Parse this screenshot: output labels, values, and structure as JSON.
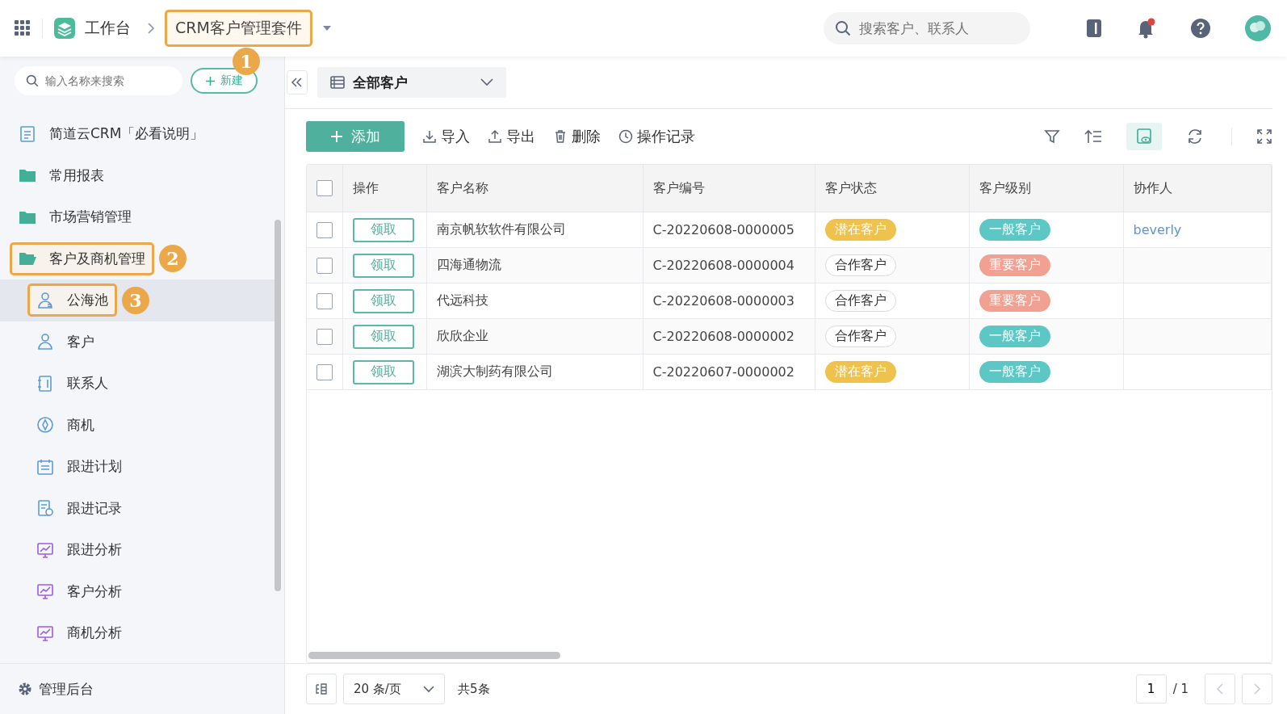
{
  "topbar": {
    "home": "工作台",
    "app": {
      "label": "CRM客户管理套件",
      "callout": "1"
    },
    "search": {
      "placeholder": "搜索客户、联系人"
    },
    "notification_dot": true
  },
  "sidebar": {
    "search": {
      "placeholder": "输入名称来搜索"
    },
    "new_button": "新建",
    "items": [
      {
        "label": "简道云CRM「必看说明」",
        "kind": "document",
        "selected": false
      },
      {
        "label": "常用报表",
        "kind": "folder",
        "selected": false,
        "expanded": false
      },
      {
        "label": "市场营销管理",
        "kind": "folder",
        "selected": false,
        "expanded": false
      },
      {
        "label": "客户及商机管理",
        "kind": "folder",
        "selected": false,
        "expanded": true,
        "callout": "2",
        "children": [
          {
            "label": "公海池",
            "kind": "pool",
            "selected": true,
            "callout": "3"
          },
          {
            "label": "客户",
            "kind": "person",
            "selected": false
          },
          {
            "label": "联系人",
            "kind": "book",
            "selected": false
          },
          {
            "label": "商机",
            "kind": "compass",
            "selected": false
          },
          {
            "label": "跟进计划",
            "kind": "calendar",
            "selected": false
          },
          {
            "label": "跟进记录",
            "kind": "record",
            "selected": false
          },
          {
            "label": "跟进分析",
            "kind": "dashboard",
            "selected": false
          },
          {
            "label": "客户分析",
            "kind": "dashboard",
            "selected": false
          },
          {
            "label": "商机分析",
            "kind": "dashboard",
            "selected": false
          }
        ]
      }
    ],
    "footer": "管理后台"
  },
  "view": {
    "title": "全部客户"
  },
  "toolbar": {
    "add": "添加",
    "actions": [
      {
        "label": "导入",
        "kind": "import"
      },
      {
        "label": "导出",
        "kind": "export"
      },
      {
        "label": "删除",
        "kind": "delete"
      },
      {
        "label": "操作记录",
        "kind": "history"
      }
    ]
  },
  "table": {
    "select_all_checked": false,
    "columns": [
      "操作",
      "客户名称",
      "客户编号",
      "客户状态",
      "客户级别",
      "协作人"
    ],
    "rows": [
      {
        "checked": false,
        "action": "领取",
        "name": "南京帆软软件有限公司",
        "code": "C-20220608-0000005",
        "status": {
          "label": "潜在客户",
          "kind": "filled",
          "color": "#efc24e"
        },
        "level": {
          "label": "一般客户",
          "color": "#5cc7c5"
        },
        "collaborator": "beverly"
      },
      {
        "checked": false,
        "action": "领取",
        "name": "四海通物流",
        "code": "C-20220608-0000004",
        "status": {
          "label": "合作客户",
          "kind": "outline"
        },
        "level": {
          "label": "重要客户",
          "color": "#f0a192"
        }
      },
      {
        "checked": false,
        "action": "领取",
        "name": "代远科技",
        "code": "C-20220608-0000003",
        "status": {
          "label": "合作客户",
          "kind": "outline"
        },
        "level": {
          "label": "重要客户",
          "color": "#f0a192"
        }
      },
      {
        "checked": false,
        "action": "领取",
        "name": "欣欣企业",
        "code": "C-20220608-0000002",
        "status": {
          "label": "合作客户",
          "kind": "outline"
        },
        "level": {
          "label": "一般客户",
          "color": "#5cc7c5"
        }
      },
      {
        "checked": false,
        "action": "领取",
        "name": "湖滨大制药有限公司",
        "code": "C-20220607-0000002",
        "status": {
          "label": "潜在客户",
          "kind": "filled",
          "color": "#efc24e"
        },
        "level": {
          "label": "一般客户",
          "color": "#5cc7c5"
        }
      }
    ]
  },
  "footer": {
    "page_size": "20 条/页",
    "total": "共5条",
    "page": "1",
    "pages": "/ 1"
  }
}
